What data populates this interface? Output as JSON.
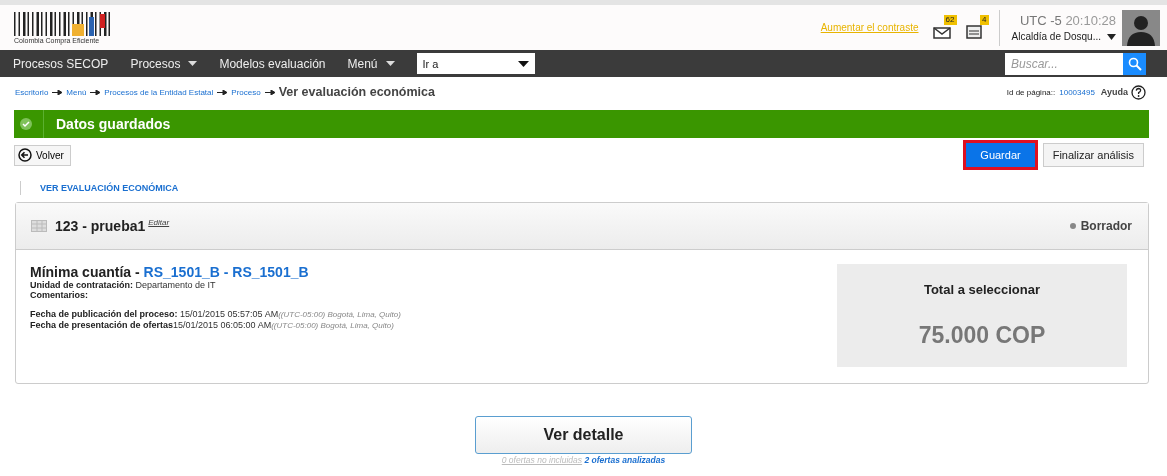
{
  "header": {
    "logo_text": "Colombia Compra Eficiente",
    "contrast_link": "Aumentar el contraste",
    "notifications": [
      {
        "kind": "mail",
        "count": "62"
      },
      {
        "kind": "doc",
        "count": "4"
      }
    ],
    "timezone": "UTC -5",
    "time": "20:10:28",
    "entity": "Alcaldía de Dosqu..."
  },
  "nav": {
    "items": [
      {
        "label": "Procesos SECOP",
        "dropdown": false
      },
      {
        "label": "Procesos",
        "dropdown": true
      },
      {
        "label": "Modelos evaluación",
        "dropdown": false
      },
      {
        "label": "Menú",
        "dropdown": true
      }
    ],
    "goto_value": "Ir a",
    "search_placeholder": "Buscar..."
  },
  "breadcrumb": {
    "links": [
      "Escritorio",
      "Menú",
      "Procesos de la Entidad Estatal",
      "Proceso"
    ],
    "current": "Ver evaluación económica",
    "page_id_label": "Id de página::",
    "page_id": "10003495",
    "help": "Ayuda"
  },
  "alert": "Datos guardados",
  "toolbar": {
    "back": "Volver",
    "buttons": [
      {
        "label": "Guardar",
        "kind": "primary",
        "highlighted": true
      },
      {
        "label": "Finalizar análisis",
        "kind": "default",
        "highlighted": false
      }
    ]
  },
  "section_title": "VER EVALUACIÓN ECONÓMICA",
  "card": {
    "title": "123 - prueba1",
    "edit": "Editar",
    "status": "Borrador",
    "type": "Mínima cuantía - ",
    "code": "RS_1501_B - RS_1501_B",
    "fields": [
      {
        "label": "Unidad de contratación:",
        "value": " Departamento de IT"
      },
      {
        "label": "Comentarios:"
      }
    ],
    "dates": [
      {
        "label": "Fecha de publicación del proceso:",
        "value": " 15/01/2015 05:57:05 AM",
        "note": "((UTC-05:00) Bogotá, Lima, Quito)"
      },
      {
        "label": "Fecha de presentación de ofertas",
        "value": "15/01/2015 06:05:00 AM",
        "note": "((UTC-05:00) Bogotá, Lima, Quito)"
      }
    ],
    "total_label": "Total a seleccionar",
    "total_value": "75.000 COP"
  },
  "detail_button": "Ver detalle",
  "offers": {
    "excluded": "0 ofertas no incluidas",
    "analyzed": "2 ofertas analizadas"
  }
}
